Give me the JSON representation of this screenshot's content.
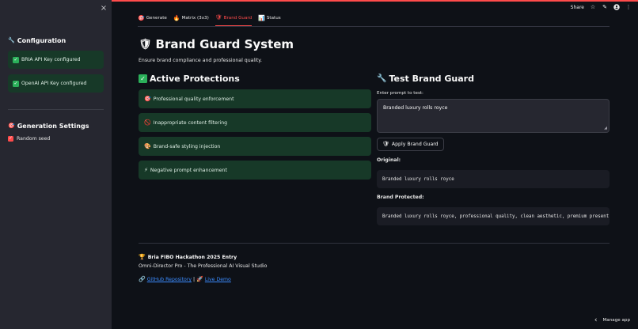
{
  "colors": {
    "accent": "#ff4b4b",
    "success_bg": "#173928",
    "link": "#3b8cff"
  },
  "sidebar": {
    "close_icon": "×",
    "config_heading": "Configuration",
    "config_icon": "🔧",
    "status": [
      {
        "label": "BRIA API Key configured"
      },
      {
        "label": "OpenAI API Key configured"
      }
    ],
    "gen_heading": "Generation Settings",
    "gen_icon": "🎯",
    "random_seed_label": "Random seed",
    "random_seed_checked": true
  },
  "toolbar": {
    "share_label": "Share",
    "star_icon": "☆",
    "edit_icon": "✎",
    "github_icon": "github-icon",
    "menu_icon": "⋮"
  },
  "tabs": [
    {
      "icon": "🎯",
      "label": "Generate"
    },
    {
      "icon": "🔥",
      "label": "Matrix (3x3)"
    },
    {
      "icon": "🛡",
      "label": "Brand Guard",
      "active": true
    },
    {
      "icon": "📊",
      "label": "Status"
    }
  ],
  "main": {
    "title_icon": "🛡",
    "title": "Brand Guard System",
    "subtitle": "Ensure brand compliance and professional quality.",
    "protections_heading": "Active Protections",
    "protections": [
      {
        "icon": "🎯",
        "label": "Professional quality enforcement"
      },
      {
        "icon": "🚫",
        "label": "Inappropriate content filtering"
      },
      {
        "icon": "🎨",
        "label": "Brand-safe styling injection"
      },
      {
        "icon": "⚡",
        "label": "Negative prompt enhancement"
      }
    ],
    "test_heading_icon": "🔧",
    "test_heading": "Test Brand Guard",
    "prompt_label": "Enter prompt to test:",
    "prompt_value": "Branded luxury rolls royce",
    "apply_icon": "🛡",
    "apply_label": "Apply Brand Guard",
    "original_label": "Original:",
    "original_value": "Branded luxury rolls royce",
    "protected_label": "Brand Protected:",
    "protected_value": "Branded luxury rolls royce, professional quality, clean aesthetic, premium present"
  },
  "footer": {
    "trophy_icon": "🏆",
    "entry": "Bria FIBO Hackathon 2025 Entry",
    "tagline": "Omni-Director Pro - The Professional AI Visual Studio",
    "link_icon": "🔗",
    "github_link": "GitHub Repository",
    "separator": "|",
    "rocket_icon": "🚀",
    "demo_link": "Live Demo"
  },
  "manage_app": {
    "chevron": "‹",
    "label": "Manage app"
  }
}
